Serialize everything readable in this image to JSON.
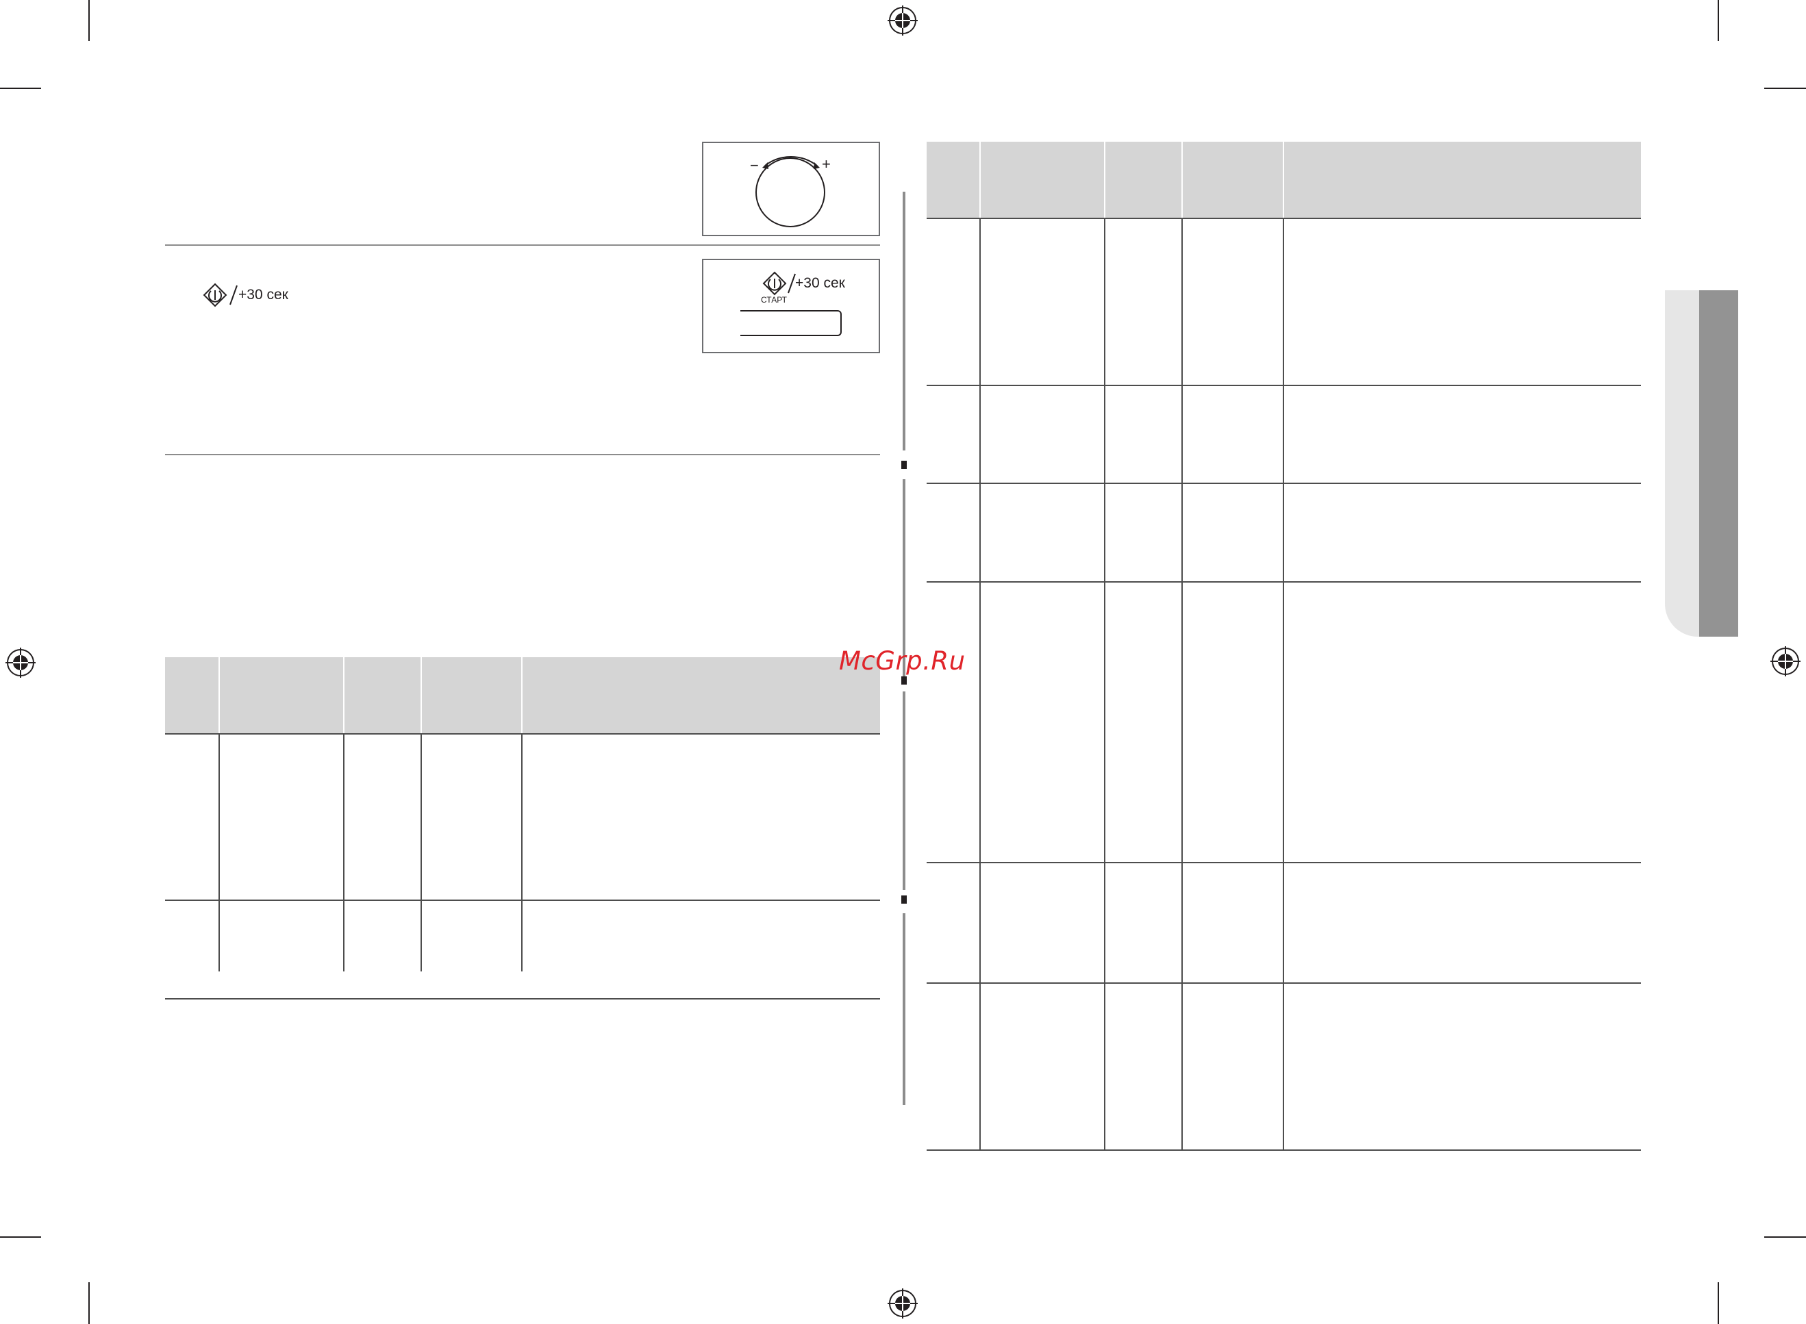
{
  "watermark": "McGrp.Ru",
  "dial_panel": {
    "minus": "−",
    "plus": "+"
  },
  "start_panel": {
    "time_label": "+30 сек",
    "start_label": "СТАРТ"
  },
  "left_text": {
    "start_time_label": "+30 сек"
  },
  "colors": {
    "watermark": "#e0242a",
    "table_header": "#d5d5d5",
    "tab_dark": "#939393",
    "tab_light": "#e6e6e6"
  }
}
